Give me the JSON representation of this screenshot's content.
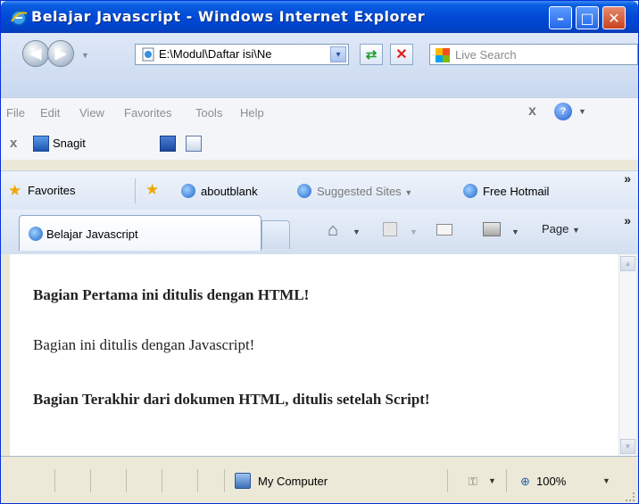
{
  "window": {
    "title": "Belajar Javascript - Windows Internet Explorer",
    "minimize_glyph": "–",
    "maximize_glyph": "□",
    "close_glyph": "✕",
    "icon": "ie-logo-icon"
  },
  "address_bar": {
    "url": "E:\\Modul\\Daftar isi\\Ne",
    "dropdown_glyph": "▾"
  },
  "search": {
    "placeholder": "Live Search"
  },
  "menu": {
    "items": [
      "File",
      "Edit",
      "View",
      "Favorites",
      "Tools",
      "Help"
    ],
    "close_glyph": "x"
  },
  "snagit": {
    "label": "Snagit",
    "close_glyph": "x"
  },
  "favorites_bar": {
    "favorites_label": "Favorites",
    "links": [
      "aboutblank",
      "Suggested Sites",
      "Free Hotmail"
    ],
    "overflow": "»"
  },
  "tabs": {
    "active_label": "Belajar Javascript",
    "page_label": "Page",
    "overflow": "»"
  },
  "content": {
    "heading_first": "Bagian Pertama ini ditulis dengan HTML!",
    "js_line": "Bagian ini ditulis dengan Javascript!",
    "heading_last": "Bagian Terakhir dari dokumen HTML, ditulis setelah Script!"
  },
  "status_bar": {
    "zone": "My Computer",
    "zoom": "100%"
  },
  "colors": {
    "titlebar": "#0049d6",
    "frame": "#ece9d8",
    "toolbar": "#dfe8f7"
  }
}
